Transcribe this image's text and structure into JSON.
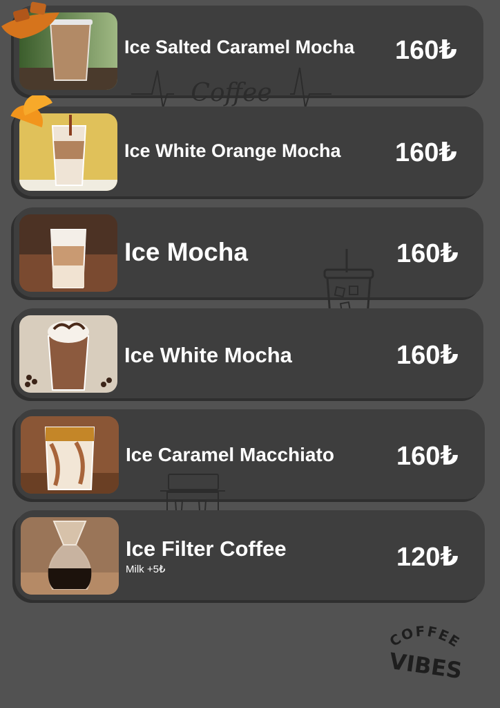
{
  "menu": {
    "items": [
      {
        "name": "Ice Salted Caramel Mocha",
        "price": "160₺",
        "image": "iced-caramel-mocha-photo"
      },
      {
        "name": "Ice White Orange Mocha",
        "price": "160₺",
        "image": "iced-white-orange-mocha-photo"
      },
      {
        "name": "Ice Mocha",
        "price": "160₺",
        "image": "iced-mocha-photo"
      },
      {
        "name": "Ice White Mocha",
        "price": "160₺",
        "image": "iced-white-mocha-photo"
      },
      {
        "name": "Ice Caramel Macchiato",
        "price": "160₺",
        "image": "iced-caramel-macchiato-photo"
      },
      {
        "name": "Ice Filter Coffee",
        "price": "120₺",
        "note": "Milk +5₺",
        "image": "iced-filter-coffee-photo"
      }
    ]
  },
  "decor": {
    "heartbeat_text": "Coffee",
    "logo_line1": "COFFEE",
    "logo_line2": "VIBES"
  },
  "colors": {
    "background": "#525252",
    "card": "#3e3e3e",
    "text": "#ffffff"
  }
}
